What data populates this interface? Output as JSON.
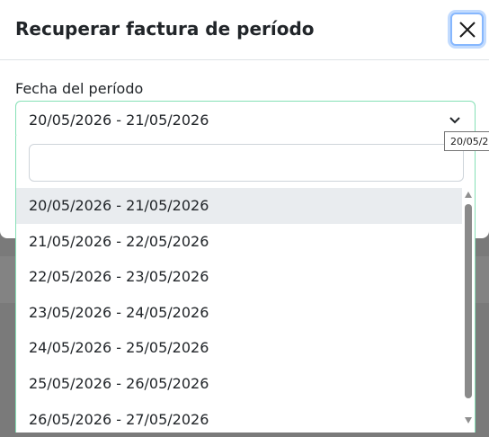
{
  "modal": {
    "title": "Recuperar factura de período",
    "close_label": "Close"
  },
  "field": {
    "label": "Fecha del período",
    "selected_value": "20/05/2026 - 21/05/2026",
    "tooltip": "20/05/2"
  },
  "dropdown": {
    "search_value": "",
    "options": [
      "20/05/2026 - 21/05/2026",
      "21/05/2026 - 22/05/2026",
      "22/05/2026 - 23/05/2026",
      "23/05/2026 - 24/05/2026",
      "24/05/2026 - 25/05/2026",
      "25/05/2026 - 26/05/2026",
      "26/05/2026 - 27/05/2026"
    ],
    "selected_index": 0
  },
  "icons": {
    "close": "close-icon",
    "chevron": "chevron-down-icon"
  },
  "colors": {
    "focus_border": "#86e0b6",
    "focus_ring": "#86b7fe",
    "selected_option_bg": "#e9ecef"
  }
}
